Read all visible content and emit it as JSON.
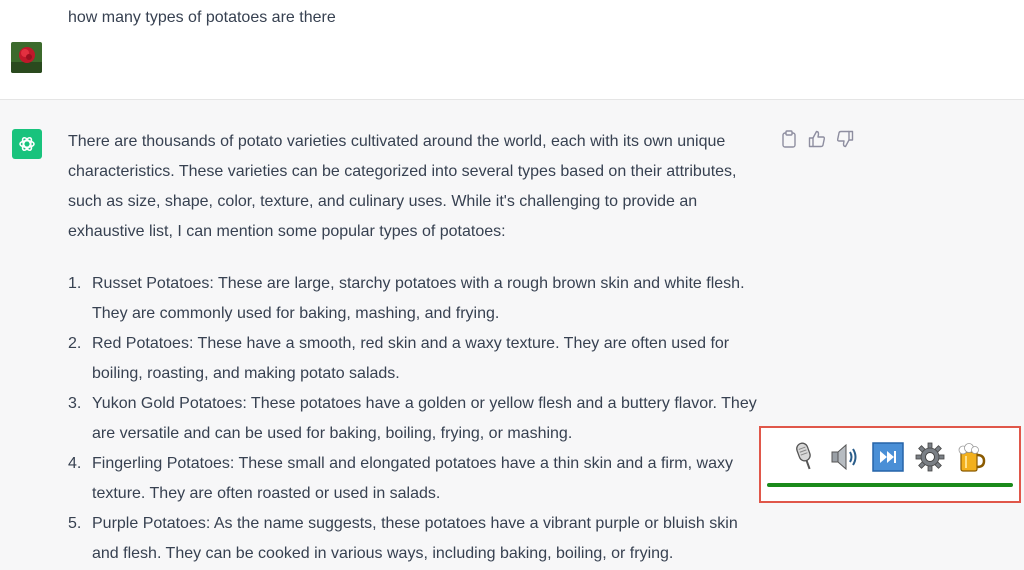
{
  "user_message": {
    "avatar": "user-avatar-rose-photo",
    "text": "how many types of potatoes are there"
  },
  "assistant_message": {
    "avatar": "chatgpt-logo-icon",
    "intro": "There are thousands of potato varieties cultivated around the world, each with its own unique characteristics. These varieties can be categorized into several types based on their attributes, such as size, shape, color, texture, and culinary uses. While it's challenging to provide an exhaustive list, I can mention some popular types of potatoes:",
    "items": [
      {
        "num": "1.",
        "text": "Russet Potatoes: These are large, starchy potatoes with a rough brown skin and white flesh. They are commonly used for baking, mashing, and frying."
      },
      {
        "num": "2.",
        "text": "Red Potatoes: These have a smooth, red skin and a waxy texture. They are often used for boiling, roasting, and making potato salads."
      },
      {
        "num": "3.",
        "text": "Yukon Gold Potatoes: These potatoes have a golden or yellow flesh and a buttery flavor. They are versatile and can be used for baking, boiling, frying, or mashing."
      },
      {
        "num": "4.",
        "text": "Fingerling Potatoes: These small and elongated potatoes have a thin skin and a firm, waxy texture. They are often roasted or used in salads."
      },
      {
        "num": "5.",
        "text": "Purple Potatoes: As the name suggests, these potatoes have a vibrant purple or bluish skin and flesh. They can be cooked in various ways, including baking, boiling, or frying."
      }
    ],
    "feedback_icons": [
      "copy-icon",
      "thumbs-up-icon",
      "thumbs-down-icon"
    ]
  },
  "extension_toolbar": {
    "icons": [
      "microphone-icon",
      "speaker-icon",
      "skip-forward-icon",
      "settings-gear-icon",
      "beer-mug-icon"
    ],
    "highlight_color": "#e0574a",
    "bar_color": "#1a8a1a"
  }
}
